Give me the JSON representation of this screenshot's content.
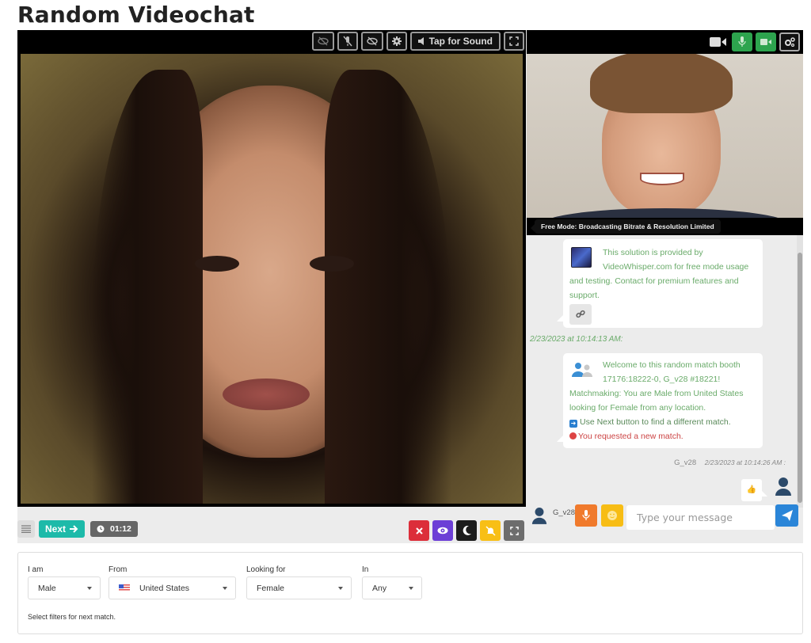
{
  "page": {
    "title": "Random Videochat"
  },
  "remote_toolbar": {
    "buttons": [
      {
        "icon": "eye-slash-icon"
      },
      {
        "icon": "microphone-slash-icon"
      },
      {
        "icon": "eye-slash-icon"
      },
      {
        "icon": "gear-icon"
      }
    ],
    "sound_button_label": "Tap for Sound",
    "sound_icon": "volume-icon",
    "fullscreen_icon": "expand-icon"
  },
  "local_toolbar": {
    "buttons": [
      {
        "icon": "video-camera-icon",
        "state": "plain"
      },
      {
        "icon": "microphone-icon",
        "state": "active"
      },
      {
        "icon": "video-camera-icon",
        "state": "active"
      },
      {
        "icon": "cogs-icon",
        "state": "outline"
      }
    ],
    "colors": {
      "active": "#2da44e"
    }
  },
  "local_video": {
    "notice": "Free Mode: Broadcasting Bitrate & Resolution Limited"
  },
  "chat": {
    "messages": [
      {
        "type": "system",
        "icon": "videowhisper-logo",
        "text": "This solution is provided by VideoWhisper.com for free mode usage and testing. Contact for premium features and support.",
        "action_icon": "link-icon"
      },
      {
        "type": "timestamp",
        "text": "2/23/2023 at 10:14:13 AM:"
      },
      {
        "type": "system",
        "icon": "users-icon",
        "lines": [
          "Welcome to this random match booth 17176:18222-0, G_v28 #18221!",
          "Matchmaking: You are Male from United States looking for Female from any location."
        ],
        "next_hint": "Use Next button to find a different match.",
        "request_notice": "You requested a new match."
      },
      {
        "type": "meta",
        "user": "G_v28",
        "time": "2/23/2023 at 10:14:26 AM :"
      },
      {
        "type": "reaction",
        "icon": "thumbs-up-icon",
        "emoji": "👍"
      }
    ],
    "current_user": "G_v28",
    "input": {
      "placeholder": "Type your message",
      "value": ""
    },
    "colors": {
      "text": "#6aab6a",
      "mic_button": "#f07a2c",
      "emoji_button": "#f7bd15",
      "send_button": "#2a85d8"
    }
  },
  "controls": {
    "next_label": "Next",
    "timer": "01:12",
    "buttons": [
      {
        "name": "close",
        "icon": "close-icon",
        "color": "#dc2e3a"
      },
      {
        "name": "visibility",
        "icon": "eye-icon",
        "color": "#6c3fd6"
      },
      {
        "name": "dark-mode",
        "icon": "moon-icon",
        "color": "#1c1c1c"
      },
      {
        "name": "notifications",
        "icon": "bell-slash-icon",
        "color": "#f8bf16"
      },
      {
        "name": "fullscreen",
        "icon": "expand-icon",
        "color": "#6d6d6d"
      }
    ],
    "next_color": "#1dbaa9"
  },
  "filters": {
    "i_am": {
      "label": "I am",
      "value": "Male"
    },
    "from": {
      "label": "From",
      "value": "United States",
      "flag": "us-flag"
    },
    "looking_for": {
      "label": "Looking for",
      "value": "Female"
    },
    "in": {
      "label": "In",
      "value": "Any"
    },
    "hint": "Select filters for next match."
  }
}
